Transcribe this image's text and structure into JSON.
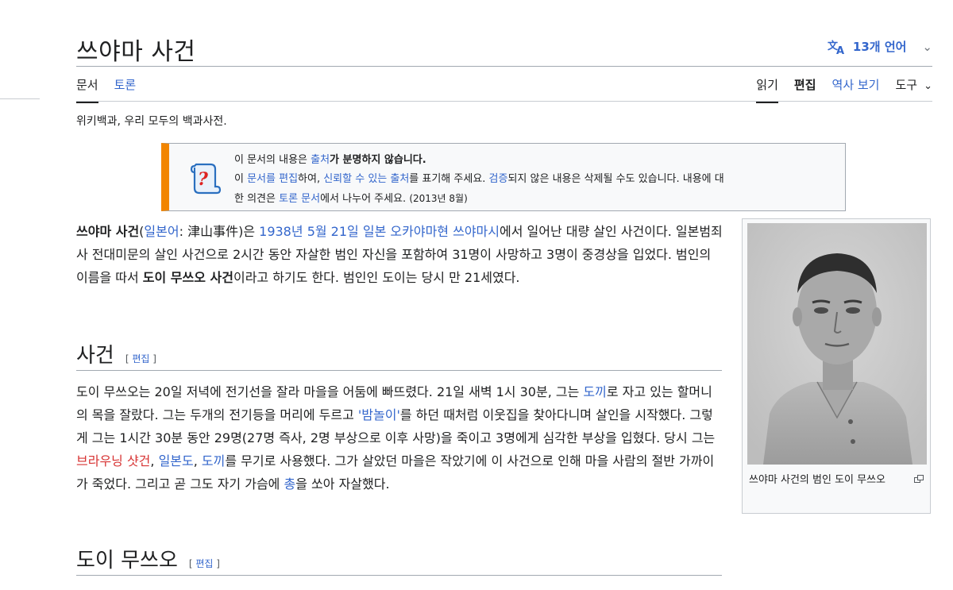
{
  "page": {
    "title": "쓰야마 사건",
    "languages_label": "13개 언어",
    "tagline": "위키백과, 우리 모두의 백과사전."
  },
  "tabs": {
    "article": "문서",
    "talk": "토론",
    "read": "읽기",
    "edit": "편집",
    "history": "역사 보기",
    "tools": "도구"
  },
  "ambox": {
    "line1_pre": "이 문서의 내용은 ",
    "line1_link": "출처",
    "line1_bold": "가 분명하지 않습니다.",
    "line2_a": "이 ",
    "line2_link1": "문서를 편집",
    "line2_b": "하여, ",
    "line2_link2": "신뢰할 수 있는 출처",
    "line2_c": "를 표기해 주세요. ",
    "line2_link3": "검증",
    "line2_d": "되지 않은 내용은 삭제될 수도 있습니다. 내용에 대",
    "line3_a": "한 의견은 ",
    "line3_link": "토론 문서",
    "line3_b": "에서 나누어 주세요. ",
    "line3_date": "(2013년 8월)"
  },
  "lead": {
    "bold_title": "쓰야마 사건",
    "paren_open": "(",
    "japanese_link": "일본어",
    "japanese_text": ": 津山事件",
    "paren_close": ")은 ",
    "date_link1": "1938년",
    "space1": " ",
    "date_link2": "5월 21일",
    "space2": " ",
    "place_link1": "일본",
    "space3": " ",
    "place_link2": "오카야마현",
    "space4": " ",
    "place_link3": "쓰야마시",
    "rest1": "에서 일어난 대량 살인 사건이다. 일본범죄사 전대미문의 살인 사건으로 2시간 동안 자살한 범인 자신을 포함하여 31명이 사망하고 3명이 중경상을 입었다. 범인의 이름을 따서 ",
    "bold_alt": "도이 무쓰오 사건",
    "rest2": "이라고 하기도 한다. 범인인 도이는 당시 만 21세였다."
  },
  "section1": {
    "title": "사건",
    "edit_open": "[ ",
    "edit_label": "편집",
    "edit_close": " ]",
    "t1": "도이 무쓰오는 20일 저녁에 전기선을 잘라 마을을 어둠에 빠뜨렸다. 21일 새벽 1시 30분, 그는 ",
    "l1": "도끼",
    "t2": "로 자고 있는 할머니의 목을 잘랐다. 그는 두개의 전기등을 머리에 두르고 ",
    "l2": "'밤놀이'",
    "t3": "를 하던 때처럼 이웃집을 찾아다니며 살인을 시작했다. 그렇게 그는 1시간 30분 동안 29명(27명 즉사, 2명 부상으로 이후 사망)을 죽이고 3명에게 심각한 부상을 입혔다. 당시 그는 ",
    "l3": "브라우닝 샷건",
    "t4": ", ",
    "l4": "일본도",
    "t5": ", ",
    "l5": "도끼",
    "t6": "를 무기로 사용했다. 그가 살았던 마을은 작았기에 이 사건으로 인해 마을 사람의 절반 가까이가 죽었다. 그리고 곧 그도 자기 가슴에 ",
    "l6": "총",
    "t7": "을 쏘아 자살했다."
  },
  "section2": {
    "title": "도이 무쓰오",
    "edit_open": "[ ",
    "edit_label": "편집",
    "edit_close": " ]"
  },
  "thumb": {
    "caption": "쓰야마 사건의 범인 도이 무쓰오"
  },
  "colors": {
    "link": "#3366cc",
    "redlink": "#d73333",
    "ambox_border": "#f28500"
  }
}
